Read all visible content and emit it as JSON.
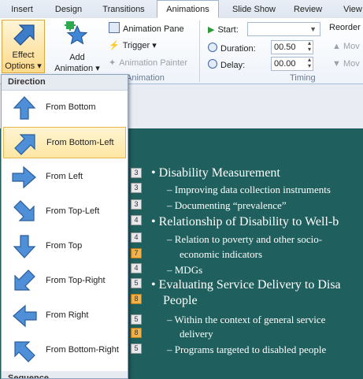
{
  "tabs": [
    {
      "label": "Insert"
    },
    {
      "label": "Design"
    },
    {
      "label": "Transitions"
    },
    {
      "label": "Animations"
    },
    {
      "label": "Slide Show"
    },
    {
      "label": "Review"
    },
    {
      "label": "View"
    }
  ],
  "ribbon": {
    "effect_options": {
      "line1": "Effect",
      "line2": "Options ▾"
    },
    "add_animation": {
      "line1": "Add",
      "line2": "Animation ▾"
    },
    "animation_pane": "Animation Pane",
    "trigger": "Trigger ▾",
    "animation_painter": "Animation Painter",
    "group_animation": "Animation",
    "start_label": "Start:",
    "start_value": "",
    "duration_label": "Duration:",
    "duration_value": "00.50",
    "delay_label": "Delay:",
    "delay_value": "00.00",
    "group_timing": "Timing",
    "reorder_label": "Reorder",
    "move_earlier": "Mov",
    "move_later": "Mov"
  },
  "dropdown": {
    "header_direction": "Direction",
    "items": [
      {
        "label": "From Bottom",
        "icon": "arrow-up-icon"
      },
      {
        "label": "From Bottom-Left",
        "icon": "arrow-up-right-icon",
        "selected": true
      },
      {
        "label": "From Left",
        "icon": "arrow-right-icon"
      },
      {
        "label": "From Top-Left",
        "icon": "arrow-down-right-icon"
      },
      {
        "label": "From Top",
        "icon": "arrow-down-icon"
      },
      {
        "label": "From Top-Right",
        "icon": "arrow-down-left-icon"
      },
      {
        "label": "From Right",
        "icon": "arrow-left-icon"
      },
      {
        "label": "From Bottom-Right",
        "icon": "arrow-up-left-icon"
      }
    ],
    "header_sequence": "Sequence"
  },
  "slide": {
    "lines": [
      {
        "level": 1,
        "text": "Disability Measurement",
        "badges": [
          "3"
        ]
      },
      {
        "level": 2,
        "text": "Improving data collection instruments",
        "badges": [
          "3"
        ]
      },
      {
        "level": 2,
        "text": "Documenting “prevalence”",
        "badges": [
          "3"
        ]
      },
      {
        "level": 1,
        "text": "Relationship of Disability to Well-b",
        "badges": [
          "4"
        ]
      },
      {
        "level": 2,
        "text": "Relation to poverty and other socio-",
        "badges": [
          "4"
        ]
      },
      {
        "level": 2,
        "text": "economic indicators",
        "badges": [
          "7"
        ]
      },
      {
        "level": 2,
        "text": "MDGs",
        "badges": [
          "4"
        ]
      },
      {
        "level": 1,
        "text": "Evaluating Service Delivery to Disa",
        "badges": [
          "5"
        ]
      },
      {
        "level": 1,
        "text": "People",
        "badges": [
          "8"
        ]
      },
      {
        "level": 2,
        "text": "Within the context of general service",
        "badges": [
          "5"
        ]
      },
      {
        "level": 2,
        "text": "delivery",
        "badges": [
          "8"
        ]
      },
      {
        "level": 2,
        "text": "Programs targeted to disabled people",
        "badges": [
          "5"
        ]
      }
    ]
  }
}
